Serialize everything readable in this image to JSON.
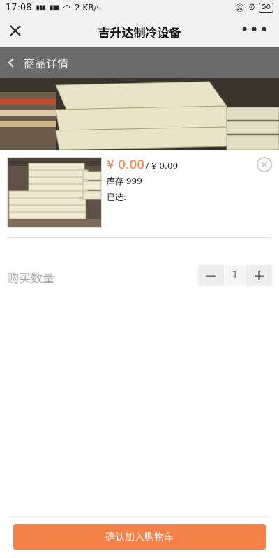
{
  "status_bar": {
    "time": "17:08",
    "signal": "4G",
    "network_speed": "2 KB/s",
    "battery": "50"
  },
  "nav": {
    "title": "吉升达制冷设备",
    "more_label": "•••"
  },
  "page": {
    "header_title": "商品详情"
  },
  "product": {
    "price": "¥ 0.00",
    "original_price": "/ ¥ 0.00",
    "stock": "库存 999",
    "selected": "已选:"
  },
  "quantity": {
    "label": "购买数量",
    "value": "1",
    "minus": "−",
    "plus": "+"
  },
  "actions": {
    "confirm": "确认加入购物车"
  },
  "colors": {
    "accent": "#f48147",
    "price": "#f47b3b"
  }
}
